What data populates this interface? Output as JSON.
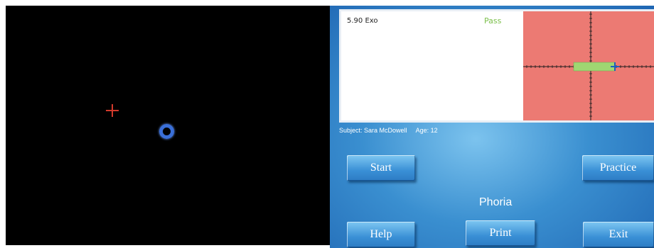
{
  "result": {
    "measurement": "5.90 Exo",
    "status": "Pass",
    "status_color": "#7bbf4a",
    "plot_background": "#ec7a73",
    "passband_color": "#9fd672"
  },
  "subject": {
    "name_text": "Subject: Sara McDowell",
    "age_text": "Age: 12"
  },
  "buttons": {
    "start": "Start",
    "practice": "Practice",
    "help": "Help",
    "print": "Print",
    "exit": "Exit"
  },
  "mode_title": "Phoria",
  "stimulus": {
    "fixation_marker": "red-cross",
    "target_marker": "blue-ring"
  }
}
